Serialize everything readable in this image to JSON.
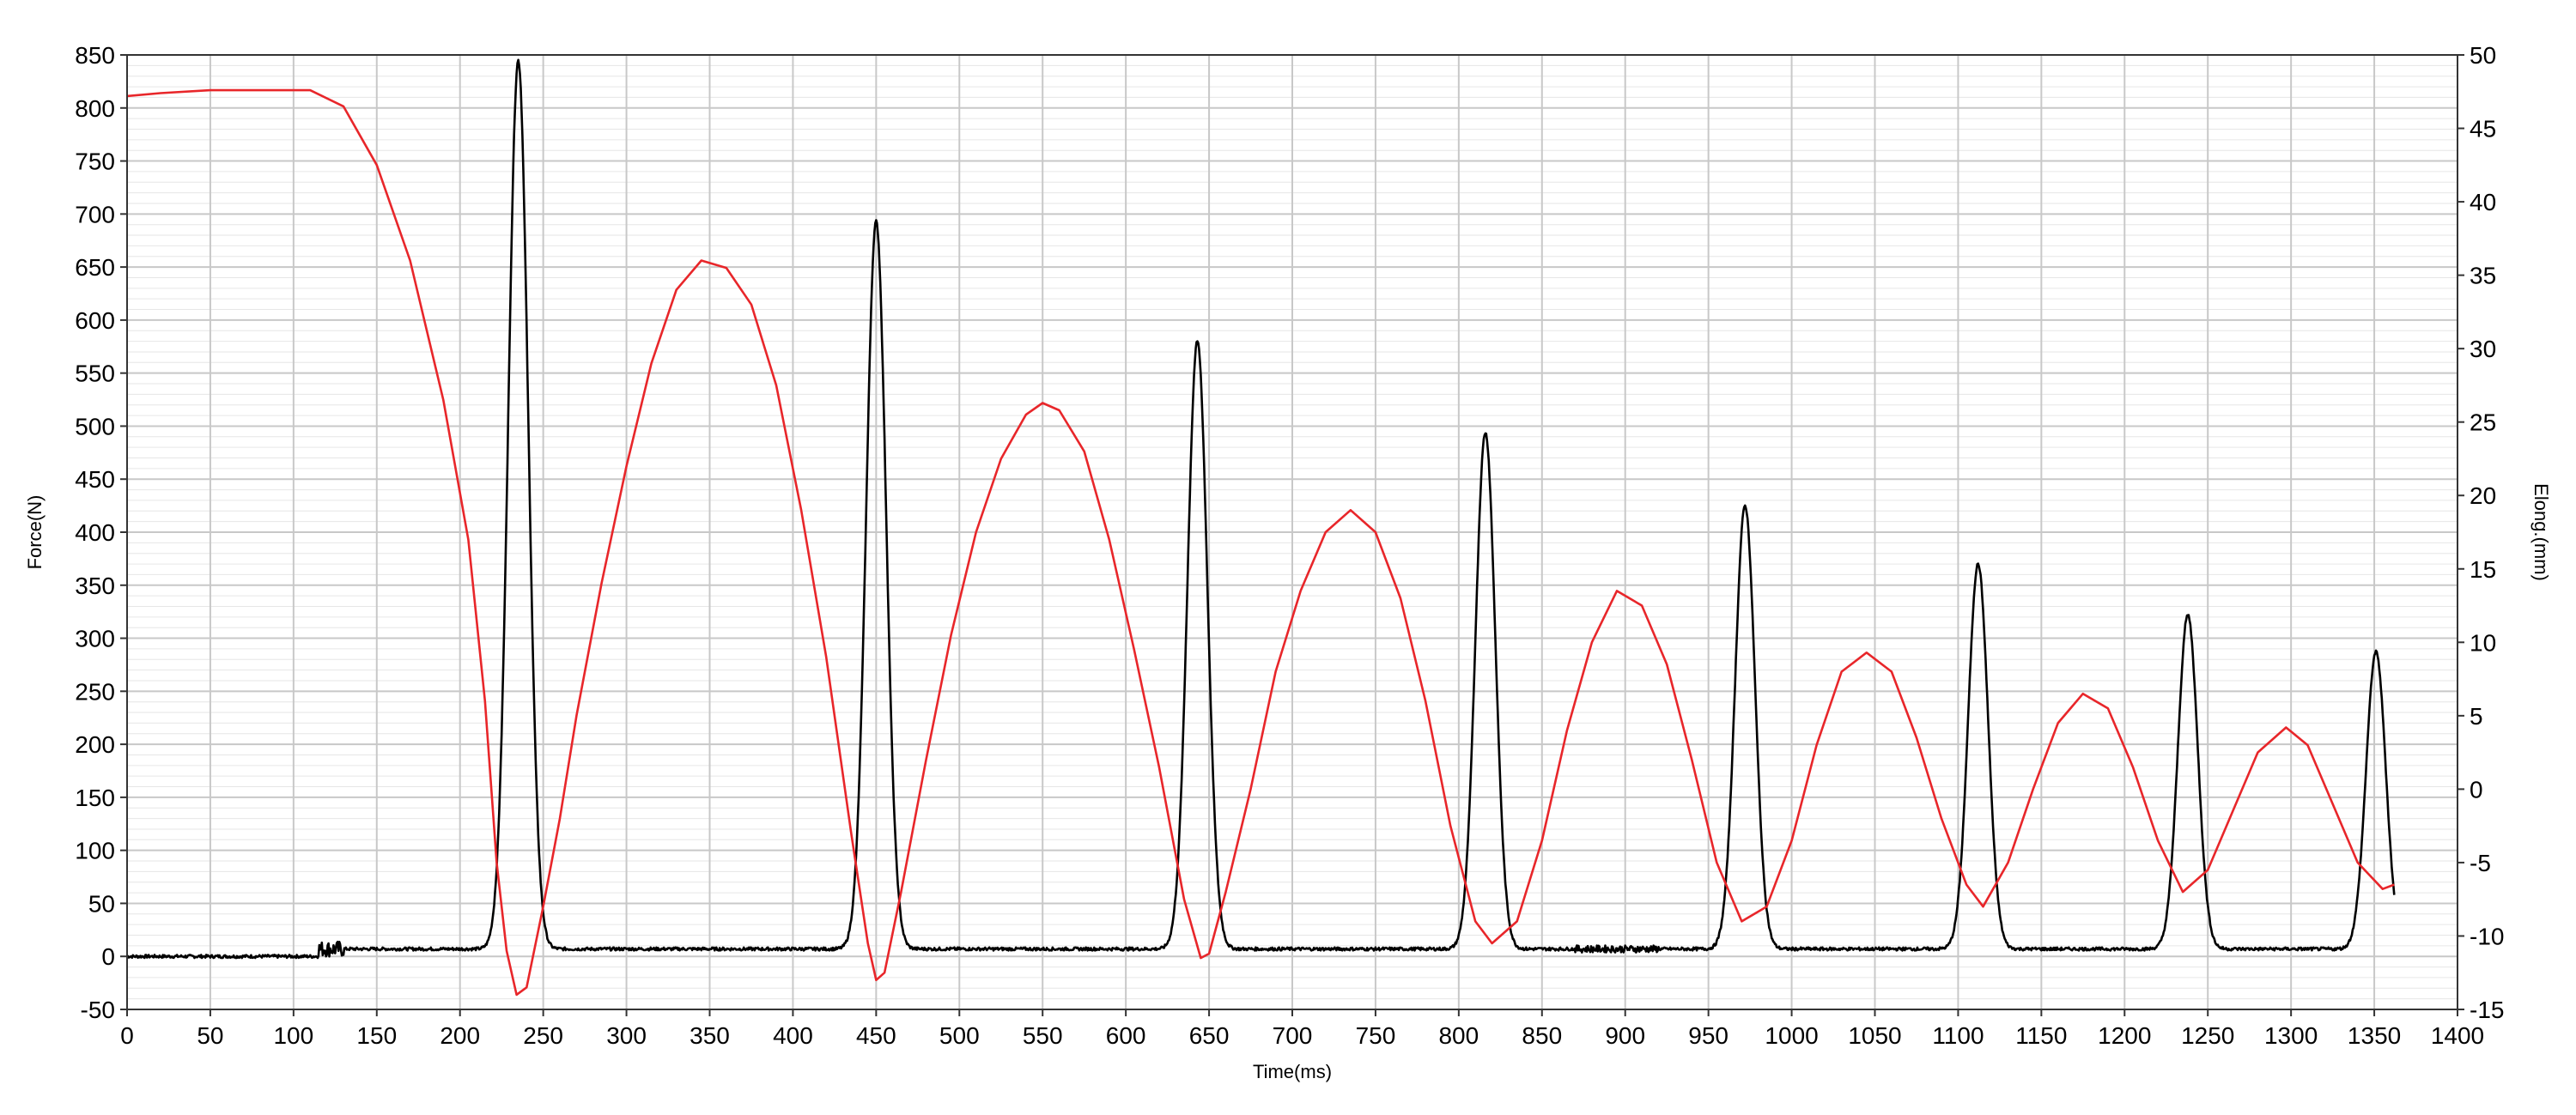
{
  "chart_data": {
    "type": "line",
    "xlabel": "Time(ms)",
    "ylabel": "Force(N)",
    "y2label": "Elong.(mm)",
    "xlim": [
      0,
      1400
    ],
    "ylim": [
      -50,
      850
    ],
    "y2lim": [
      -15,
      50
    ],
    "x_ticks": [
      0,
      50,
      100,
      150,
      200,
      250,
      300,
      350,
      400,
      450,
      500,
      550,
      600,
      650,
      700,
      750,
      800,
      850,
      900,
      950,
      1000,
      1050,
      1100,
      1150,
      1200,
      1250,
      1300,
      1350,
      1400
    ],
    "y_ticks": [
      -50,
      0,
      50,
      100,
      150,
      200,
      250,
      300,
      350,
      400,
      450,
      500,
      550,
      600,
      650,
      700,
      750,
      800,
      850
    ],
    "y2_ticks": [
      -15,
      -10,
      -5,
      0,
      5,
      10,
      15,
      20,
      25,
      30,
      35,
      40,
      45,
      50
    ],
    "grid": true,
    "series": [
      {
        "color": "#000000",
        "axis": "left",
        "baseline": 7,
        "peaks": [
          {
            "x": 235,
            "y": 845,
            "half_width": 20
          },
          {
            "x": 450,
            "y": 693,
            "half_width": 20
          },
          {
            "x": 643,
            "y": 580,
            "half_width": 20
          },
          {
            "x": 816,
            "y": 494,
            "half_width": 20
          },
          {
            "x": 972,
            "y": 425,
            "half_width": 20
          },
          {
            "x": 1112,
            "y": 370,
            "half_width": 20
          },
          {
            "x": 1238,
            "y": 322,
            "half_width": 20
          },
          {
            "x": 1351,
            "y": 287,
            "half_width": 20
          }
        ],
        "end_x": 1362
      },
      {
        "color": "#e8262a",
        "axis": "right",
        "points": [
          [
            0,
            47.2
          ],
          [
            20,
            47.4
          ],
          [
            50,
            47.6
          ],
          [
            80,
            47.6
          ],
          [
            110,
            47.6
          ],
          [
            130,
            46.5
          ],
          [
            150,
            42.5
          ],
          [
            170,
            36
          ],
          [
            190,
            26.5
          ],
          [
            205,
            17
          ],
          [
            215,
            6
          ],
          [
            222,
            -5
          ],
          [
            228,
            -11
          ],
          [
            234,
            -14
          ],
          [
            240,
            -13.5
          ],
          [
            250,
            -8
          ],
          [
            260,
            -2
          ],
          [
            270,
            5
          ],
          [
            285,
            14
          ],
          [
            300,
            22
          ],
          [
            315,
            29
          ],
          [
            330,
            34
          ],
          [
            345,
            36
          ],
          [
            360,
            35.5
          ],
          [
            375,
            33
          ],
          [
            390,
            27.5
          ],
          [
            405,
            19
          ],
          [
            420,
            9
          ],
          [
            435,
            -3
          ],
          [
            445,
            -10.5
          ],
          [
            450,
            -13
          ],
          [
            455,
            -12.5
          ],
          [
            465,
            -7
          ],
          [
            480,
            2
          ],
          [
            495,
            10.5
          ],
          [
            510,
            17.5
          ],
          [
            525,
            22.5
          ],
          [
            540,
            25.5
          ],
          [
            550,
            26.3
          ],
          [
            560,
            25.8
          ],
          [
            575,
            23
          ],
          [
            590,
            17
          ],
          [
            605,
            9.5
          ],
          [
            620,
            1.5
          ],
          [
            635,
            -7.5
          ],
          [
            645,
            -11.5
          ],
          [
            650,
            -11.2
          ],
          [
            660,
            -7
          ],
          [
            675,
            0
          ],
          [
            690,
            8
          ],
          [
            705,
            13.5
          ],
          [
            720,
            17.5
          ],
          [
            735,
            19
          ],
          [
            750,
            17.5
          ],
          [
            765,
            13
          ],
          [
            780,
            6
          ],
          [
            795,
            -2.5
          ],
          [
            810,
            -9
          ],
          [
            820,
            -10.5
          ],
          [
            835,
            -9
          ],
          [
            850,
            -3.5
          ],
          [
            865,
            4
          ],
          [
            880,
            10
          ],
          [
            895,
            13.5
          ],
          [
            910,
            12.5
          ],
          [
            925,
            8.5
          ],
          [
            940,
            2
          ],
          [
            955,
            -5
          ],
          [
            970,
            -9
          ],
          [
            985,
            -8
          ],
          [
            1000,
            -3.5
          ],
          [
            1015,
            3
          ],
          [
            1030,
            8
          ],
          [
            1045,
            9.3
          ],
          [
            1060,
            8
          ],
          [
            1075,
            3.5
          ],
          [
            1090,
            -2
          ],
          [
            1105,
            -6.5
          ],
          [
            1115,
            -8
          ],
          [
            1130,
            -5
          ],
          [
            1145,
            0
          ],
          [
            1160,
            4.5
          ],
          [
            1175,
            6.5
          ],
          [
            1190,
            5.5
          ],
          [
            1205,
            1.5
          ],
          [
            1220,
            -3.5
          ],
          [
            1235,
            -7
          ],
          [
            1250,
            -5.5
          ],
          [
            1265,
            -1.5
          ],
          [
            1280,
            2.5
          ],
          [
            1297,
            4.2
          ],
          [
            1310,
            3
          ],
          [
            1325,
            -1
          ],
          [
            1340,
            -5
          ],
          [
            1355,
            -6.8
          ],
          [
            1362,
            -6.5
          ]
        ]
      }
    ]
  }
}
